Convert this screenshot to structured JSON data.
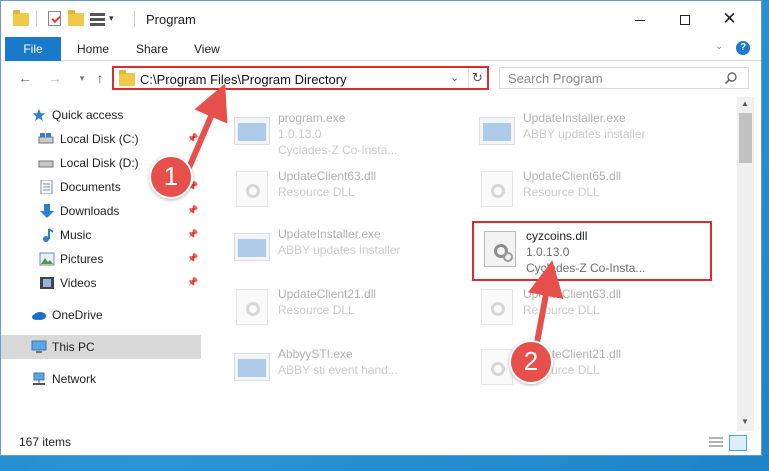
{
  "window": {
    "title": "Program"
  },
  "ribbon": {
    "tabs": [
      "File",
      "Home",
      "Share",
      "View"
    ]
  },
  "address": {
    "path": "C:\\Program Files\\Program Directory"
  },
  "search": {
    "placeholder": "Search Program"
  },
  "navpane": {
    "items": [
      {
        "label": "Quick access",
        "icon": "star-icon"
      },
      {
        "label": "Local Disk (C:)",
        "icon": "drive-icon"
      },
      {
        "label": "Local Disk (D:)",
        "icon": "drive-icon"
      },
      {
        "label": "Documents",
        "icon": "documents-icon"
      },
      {
        "label": "Downloads",
        "icon": "download-icon"
      },
      {
        "label": "Music",
        "icon": "music-icon"
      },
      {
        "label": "Pictures",
        "icon": "pictures-icon"
      },
      {
        "label": "Videos",
        "icon": "videos-icon"
      },
      {
        "label": "OneDrive",
        "icon": "cloud-icon"
      },
      {
        "label": "This PC",
        "icon": "computer-icon"
      },
      {
        "label": "Network",
        "icon": "network-icon"
      }
    ]
  },
  "files": [
    {
      "name": "program.exe",
      "line2": "1.0.13.0",
      "line3": "Cyclades-Z Co-Insta...",
      "type": "exe"
    },
    {
      "name": "UpdateInstaller.exe",
      "line2": "ABBY updates installer",
      "line3": "",
      "type": "exe"
    },
    {
      "name": "UpdateClient63.dll",
      "line2": "Resource DLL",
      "line3": "",
      "type": "dll"
    },
    {
      "name": "UpdateClient65.dll",
      "line2": "Resource DLL",
      "line3": "",
      "type": "dll"
    },
    {
      "name": "UpdateInstaller.exe",
      "line2": "ABBY updates installer",
      "line3": "",
      "type": "exe"
    },
    {
      "name": "cyzcoins.dll",
      "line2": "1.0.13.0",
      "line3": "Cyclades-Z Co-Insta...",
      "type": "dll"
    },
    {
      "name": "UpdateClient21.dll",
      "line2": "Resource DLL",
      "line3": "",
      "type": "dll"
    },
    {
      "name": "UpdateClient63.dll",
      "line2": "Resource DLL",
      "line3": "",
      "type": "dll"
    },
    {
      "name": "AbbyySTI.exe",
      "line2": "ABBY sti event hand...",
      "line3": "",
      "type": "exe"
    },
    {
      "name": "UpdateClient21.dll",
      "line2": "Resource DLL",
      "line3": "",
      "type": "dll"
    }
  ],
  "status": {
    "item_count": "167 items"
  },
  "annotations": {
    "step1": "1",
    "step2": "2",
    "color": "#e7504a"
  }
}
